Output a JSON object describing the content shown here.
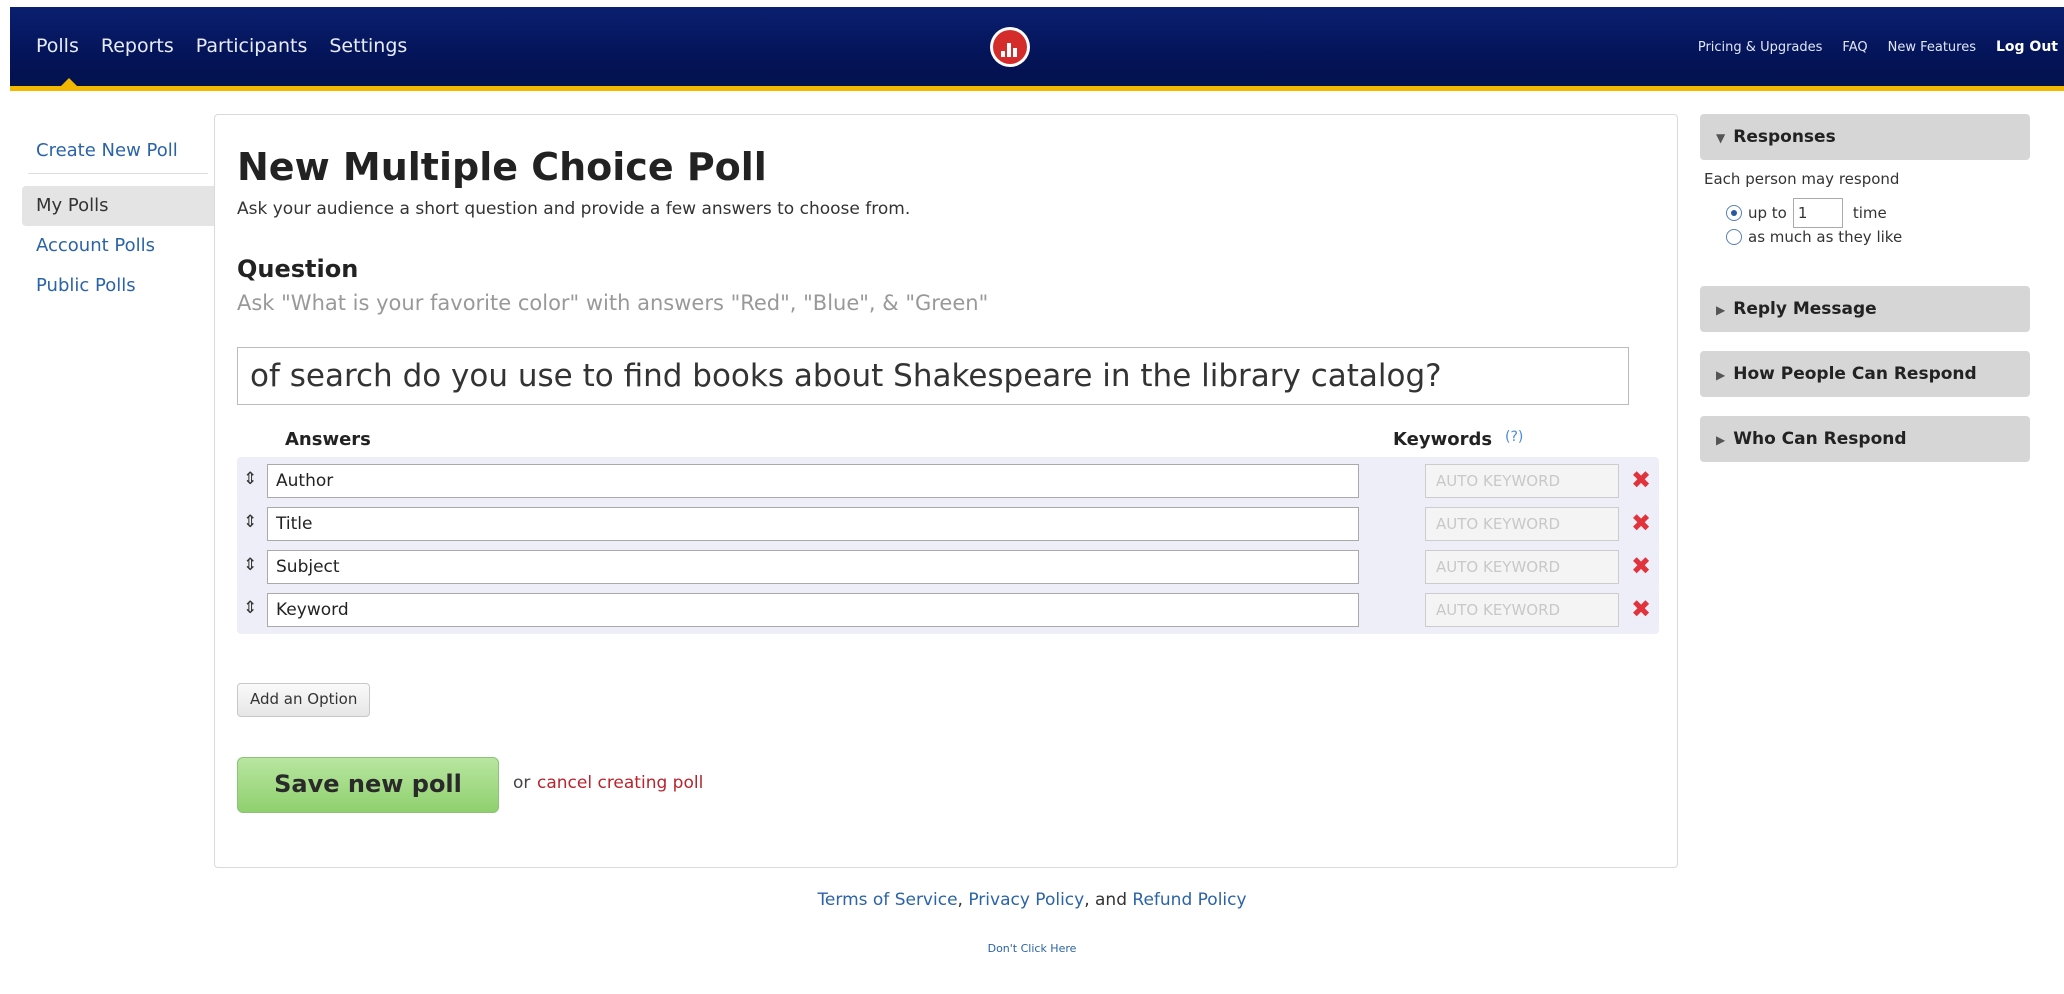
{
  "topnav": {
    "polls": "Polls",
    "reports": "Reports",
    "participants": "Participants",
    "settings": "Settings",
    "pricing": "Pricing & Upgrades",
    "faq": "FAQ",
    "new_features": "New Features",
    "logout": "Log Out"
  },
  "sidebar": {
    "create": "Create New Poll",
    "items": [
      {
        "label": "My Polls"
      },
      {
        "label": "Account Polls"
      },
      {
        "label": "Public Polls"
      }
    ]
  },
  "main": {
    "title": "New Multiple Choice Poll",
    "subtitle": "Ask your audience a short question and provide a few answers to choose from.",
    "question_label": "Question",
    "question_hint": "Ask \"What is your favorite color\" with answers \"Red\", \"Blue\", & \"Green\"",
    "question_value": "of search do you use to find books about Shakespeare in the library catalog?",
    "answers_header": "Answers",
    "keywords_header": "Keywords",
    "keywords_help": "(?)",
    "keyword_placeholder": "AUTO KEYWORD",
    "answers": [
      {
        "value": "Author"
      },
      {
        "value": "Title"
      },
      {
        "value": "Subject"
      },
      {
        "value": "Keyword"
      }
    ],
    "add_option": "Add an Option",
    "save": "Save new poll",
    "or": "or",
    "cancel": "cancel creating poll"
  },
  "right_panel": {
    "responses": "Responses",
    "each_person": "Each person may respond",
    "up_to": "up to",
    "times_value": "1",
    "time": "time",
    "as_much": "as much as they like",
    "reply_message": "Reply Message",
    "how_respond": "How People Can Respond",
    "who_respond": "Who Can Respond"
  },
  "footer": {
    "terms": "Terms of Service",
    "comma": ",",
    "privacy": "Privacy Policy",
    "and": ", and",
    "refund": "Refund Policy",
    "dont_click": "Don't Click Here"
  },
  "colors": {
    "topbar": "#041459",
    "accent": "#f2b800",
    "link": "#2b63a8",
    "cancel": "#b8242d",
    "save_green": "#8fd06e",
    "delete_red": "#e0333b"
  }
}
